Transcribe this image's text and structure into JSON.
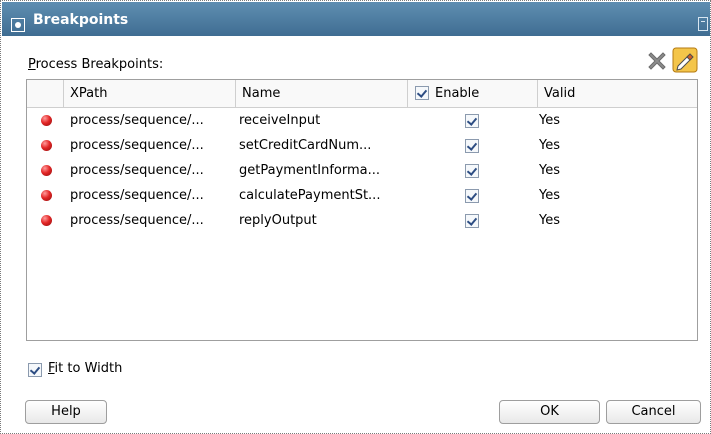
{
  "dialog": {
    "title": "Breakpoints"
  },
  "section": {
    "prefix": "P",
    "rest": "rocess Breakpoints:"
  },
  "toolbar": {
    "delete_icon": "delete-x-icon",
    "edit_icon": "edit-pencil-icon"
  },
  "table": {
    "columns": {
      "xpath": "XPath",
      "name": "Name",
      "enable": "Enable",
      "valid": "Valid"
    },
    "header_enable_checked": true,
    "rows": [
      {
        "xpath": "process/sequence/...",
        "name": "receiveInput",
        "enabled": true,
        "valid": "Yes"
      },
      {
        "xpath": "process/sequence/...",
        "name": "setCreditCardNum...",
        "enabled": true,
        "valid": "Yes"
      },
      {
        "xpath": "process/sequence/...",
        "name": "getPaymentInforma...",
        "enabled": true,
        "valid": "Yes"
      },
      {
        "xpath": "process/sequence/...",
        "name": "calculatePaymentSt...",
        "enabled": true,
        "valid": "Yes"
      },
      {
        "xpath": "process/sequence/...",
        "name": "replyOutput",
        "enabled": true,
        "valid": "Yes"
      }
    ]
  },
  "fit_to_width": {
    "checked": true,
    "prefix": "F",
    "rest": "it to Width"
  },
  "buttons": {
    "help": "Help",
    "ok": "OK",
    "cancel": "Cancel"
  },
  "colors": {
    "titlebar": "#3f6d92",
    "breakpoint": "#e32626"
  }
}
